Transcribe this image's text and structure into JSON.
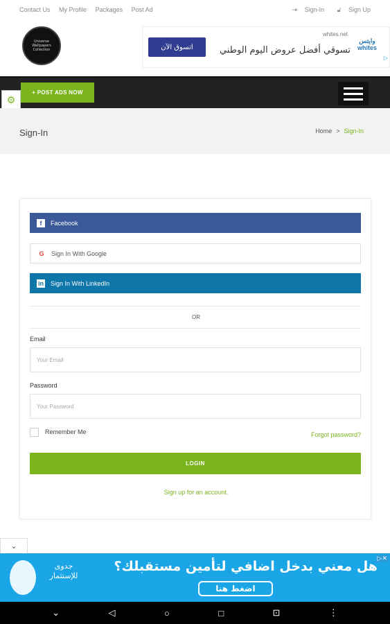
{
  "topbar": {
    "links": [
      "Contact Us",
      "My Profile",
      "Packages",
      "Post Ad"
    ],
    "signin": "Sign-In",
    "signup": "Sign Up"
  },
  "header": {
    "logo_text": "Universe Wallpapers Collection",
    "ad": {
      "domain": "whites.net",
      "headline": "تسوقي أفضل عروض اليوم الوطني",
      "button": "اتسوق الآن",
      "brand": "وايتس whites"
    }
  },
  "navbar": {
    "post_ads": "POST ADS NOW"
  },
  "breadcrumb": {
    "title": "Sign-In",
    "home": "Home",
    "separator": ">",
    "current": "Sign-In"
  },
  "signin_form": {
    "facebook": "Facebook",
    "google": "Sign In With Google",
    "linkedin": "Sign In With LinkedIn",
    "or": "OR",
    "email_label": "Email",
    "email_placeholder": "Your Email",
    "password_label": "Password",
    "password_placeholder": "Your Password",
    "remember": "Remember Me",
    "forgot": "Forgot password?",
    "login": "LOGIN",
    "signup": "Sign up for an account."
  },
  "bottom_ad": {
    "brand": "جدوى للإستثمار",
    "headline": "هل معني بدخل اضافي لتأمين مستقبلك؟",
    "cta": "اضغط هنا"
  },
  "colors": {
    "accent": "#7ab51d",
    "facebook": "#3b5998",
    "linkedin": "#0e76a8",
    "navbar": "#222222",
    "ad_blue": "#1aa6e6"
  }
}
